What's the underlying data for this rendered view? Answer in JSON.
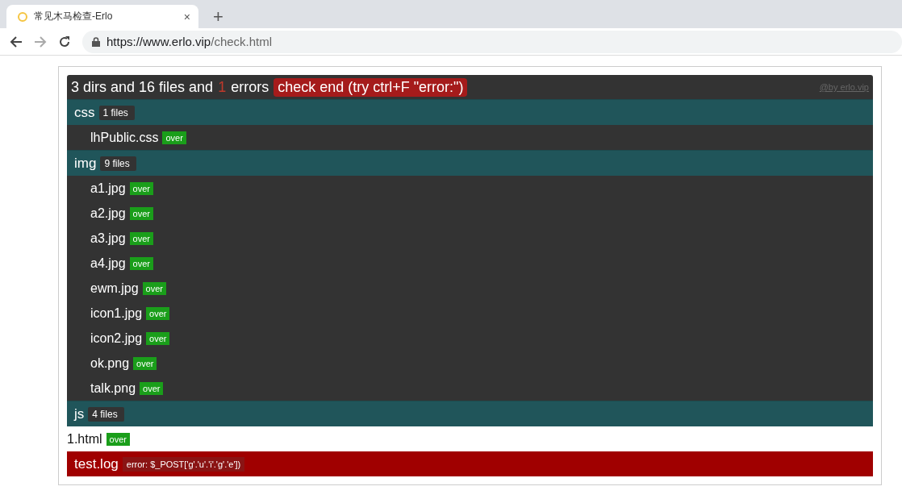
{
  "browser": {
    "tab_title": "常见木马检查-Erlo",
    "close_tab": "×",
    "new_tab": "+",
    "url_host": "https://www.erlo.vip",
    "url_path": "/check.html"
  },
  "header": {
    "summary_before": "3 dirs and 16 files and",
    "error_count": "1",
    "summary_after": "errors",
    "status": "check end (try ctrl+F \"error:\")",
    "credit": "@by erlo.vip"
  },
  "entries": [
    {
      "kind": "dir",
      "name": "css",
      "count": "1 files",
      "children": [
        {
          "kind": "file",
          "name": "lhPublic.css",
          "status": "over"
        }
      ]
    },
    {
      "kind": "dir",
      "name": "img",
      "count": "9 files",
      "children": [
        {
          "kind": "file",
          "name": "a1.jpg",
          "status": "over"
        },
        {
          "kind": "file",
          "name": "a2.jpg",
          "status": "over"
        },
        {
          "kind": "file",
          "name": "a3.jpg",
          "status": "over"
        },
        {
          "kind": "file",
          "name": "a4.jpg",
          "status": "over"
        },
        {
          "kind": "file",
          "name": "ewm.jpg",
          "status": "over"
        },
        {
          "kind": "file",
          "name": "icon1.jpg",
          "status": "over"
        },
        {
          "kind": "file",
          "name": "icon2.jpg",
          "status": "over"
        },
        {
          "kind": "file",
          "name": "ok.png",
          "status": "over"
        },
        {
          "kind": "file",
          "name": "talk.png",
          "status": "over"
        }
      ]
    },
    {
      "kind": "dir",
      "name": "js",
      "count": "4 files"
    },
    {
      "kind": "file",
      "name": "1.html",
      "status": "over"
    },
    {
      "kind": "error",
      "name": "test.log",
      "message": "error: $_POST['g'.'u'.'i'.'g'.'e'])"
    }
  ]
}
